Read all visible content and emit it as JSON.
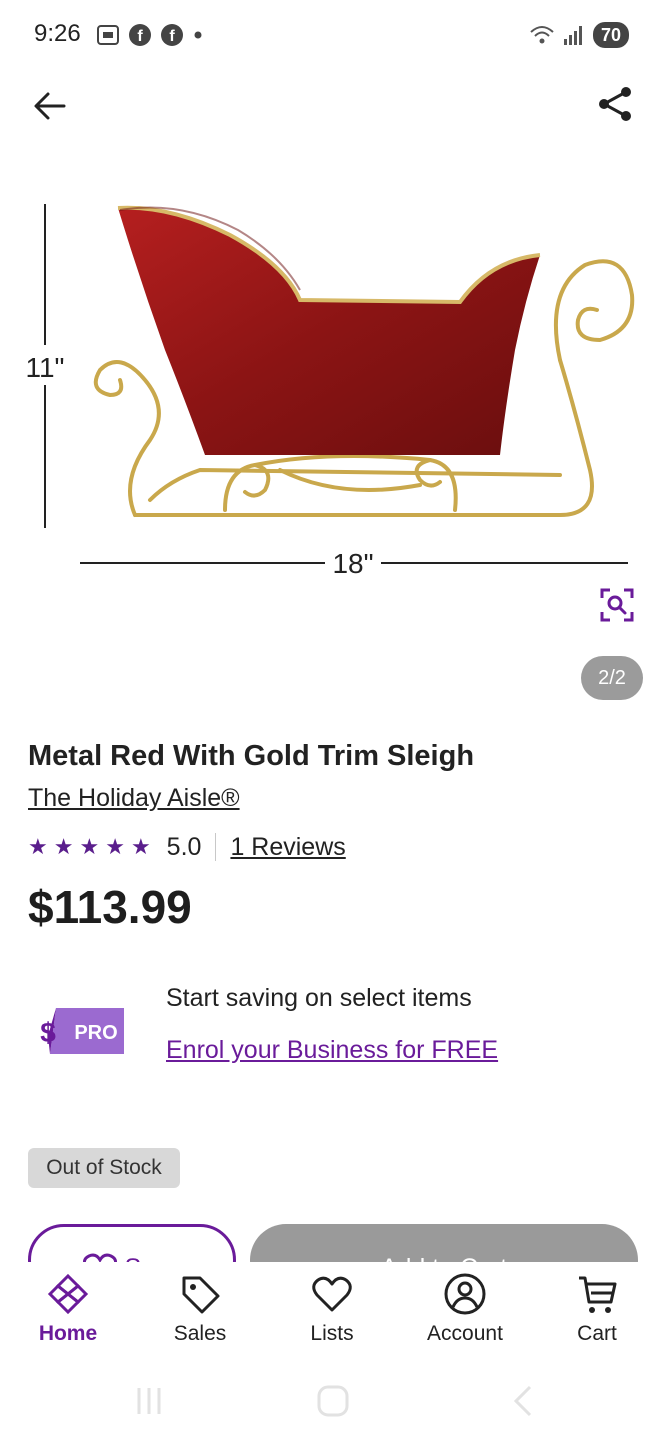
{
  "status_bar": {
    "time": "9:26",
    "battery": "70",
    "icons": [
      "screenshot-icon",
      "facebook-icon",
      "facebook-icon",
      "dot-icon",
      "wifi-icon",
      "signal-icon",
      "battery-icon"
    ]
  },
  "top_bar": {
    "back_icon": "arrow-left-icon",
    "share_icon": "share-icon"
  },
  "product_image": {
    "height_label": "11\"",
    "width_label": "18\"",
    "zoom_icon": "zoom-icon",
    "page_counter": "2/2",
    "colors": {
      "sleigh_red": "#8b1414",
      "trim_gold": "#c9a84c"
    }
  },
  "product": {
    "title": "Metal Red With Gold Trim Sleigh",
    "brand": "The Holiday Aisle®",
    "rating": "5.0",
    "reviews": "1 Reviews",
    "price": "$113.99",
    "stock_status": "Out of Stock"
  },
  "pro_banner": {
    "logo_dollar": "$",
    "logo_text": "PRO",
    "text": "Start saving on select items",
    "link": "Enrol your Business for FREE"
  },
  "actions": {
    "save_label": "Save",
    "add_to_cart_label": "Add to Cart"
  },
  "bottom_nav": {
    "items": [
      {
        "label": "Home",
        "icon": "home-icon",
        "active": true
      },
      {
        "label": "Sales",
        "icon": "tag-icon",
        "active": false
      },
      {
        "label": "Lists",
        "icon": "heart-icon",
        "active": false
      },
      {
        "label": "Account",
        "icon": "account-icon",
        "active": false
      },
      {
        "label": "Cart",
        "icon": "cart-icon",
        "active": false
      }
    ]
  },
  "colors": {
    "accent": "#6a1b9a",
    "star": "#5a1e8c",
    "disabled_button": "#9a9a9a",
    "badge_bg": "#d8d8d8"
  }
}
